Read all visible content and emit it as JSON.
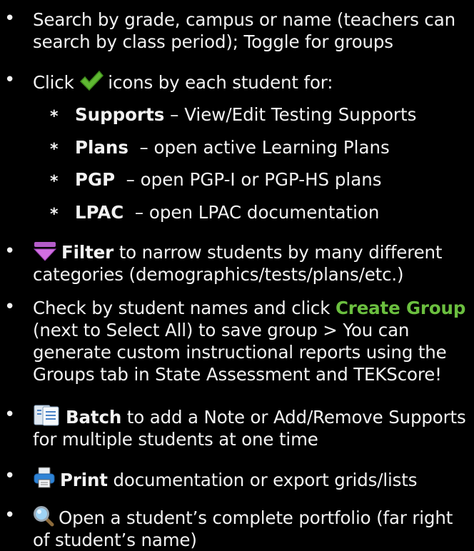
{
  "items": [
    {
      "bullet": "•",
      "text": "Search by grade, campus or name (teachers can search by class period); Toggle for groups"
    },
    {
      "bullet": "•",
      "pre": "Click",
      "icon": "checkmark-icon",
      "post": "icons by each student for:"
    },
    {
      "star": "*",
      "term": "Supports",
      "desc": "– View/Edit Testing Supports"
    },
    {
      "star": "*",
      "term": "Plans",
      "desc": "– open active Learning Plans"
    },
    {
      "star": "*",
      "term": "PGP",
      "desc": "– open PGP-I or PGP-HS plans"
    },
    {
      "star": "*",
      "term": "LPAC",
      "desc": "– open LPAC documentation"
    },
    {
      "bullet": "•",
      "icon": "filter-icon",
      "term": "Filter",
      "desc": "to narrow students by many different categories (demographics/tests/plans/etc.)"
    },
    {
      "bullet": "•",
      "pre": "Check by student names and click",
      "term": "Create Group",
      "desc": "(next to Select All) to save group > You can generate custom instructional reports using the Groups tab in State Assessment and TEKScore!"
    },
    {
      "bullet": "•",
      "icon": "batch-documents-icon",
      "term": "Batch",
      "desc": "to add a Note or Add/Remove Supports for multiple students at one time"
    },
    {
      "bullet": "•",
      "icon": "printer-icon",
      "term": "Print",
      "desc": "documentation or export grids/lists"
    },
    {
      "bullet": "•",
      "icon": "magnifier-icon",
      "desc": "Open a student’s complete portfolio (far right of student’s name)"
    }
  ],
  "colors": {
    "background": "#000000",
    "text": "#f2f2f2",
    "create_group": "#6bbf3f"
  }
}
